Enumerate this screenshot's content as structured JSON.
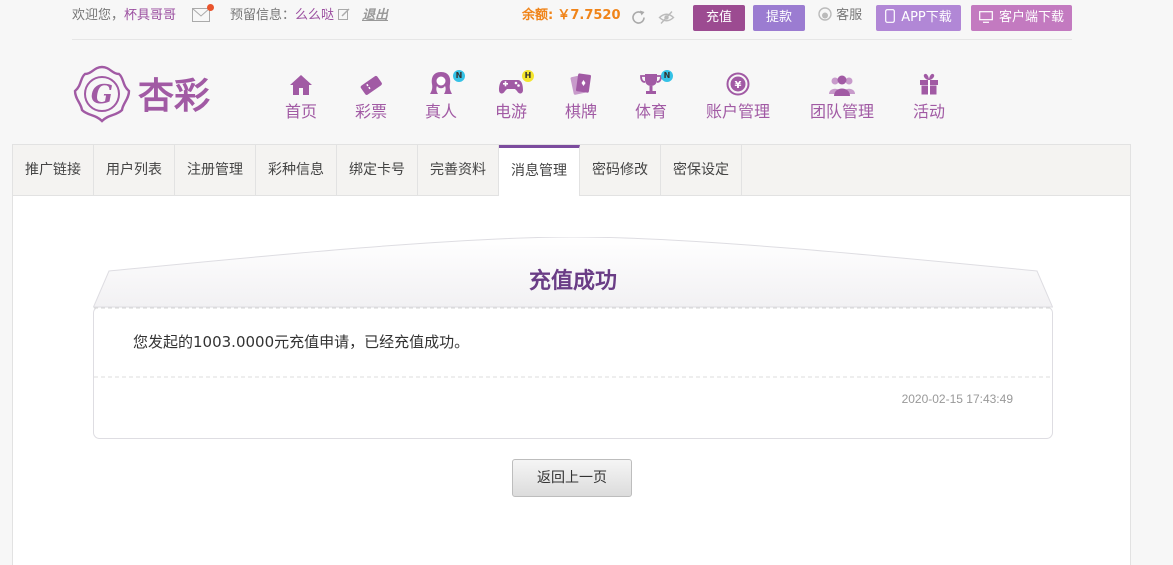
{
  "topbar": {
    "welcome": "欢迎您，",
    "username": "杯具哥哥",
    "reserved_label": "预留信息：",
    "reserved_value": "么么哒",
    "logout": "退出",
    "balance_label": "余额:",
    "balance_value": "￥7.7520",
    "recharge": "充值",
    "withdraw": "提款",
    "service": "客服",
    "app_download": "APP下载",
    "client_download": "客户端下载"
  },
  "logo": {
    "text": "杏彩"
  },
  "nav": [
    {
      "label": "首页",
      "icon": "home-icon"
    },
    {
      "label": "彩票",
      "icon": "lottery-ticket-icon"
    },
    {
      "label": "真人",
      "icon": "live-dealer-icon",
      "badge": "N"
    },
    {
      "label": "电游",
      "icon": "gamepad-icon",
      "badge": "H"
    },
    {
      "label": "棋牌",
      "icon": "cards-icon"
    },
    {
      "label": "体育",
      "icon": "trophy-icon",
      "badge": "N"
    },
    {
      "label": "账户管理",
      "icon": "yen-coin-icon"
    },
    {
      "label": "团队管理",
      "icon": "team-icon"
    },
    {
      "label": "活动",
      "icon": "gift-icon"
    }
  ],
  "tabs": [
    {
      "label": "推广链接"
    },
    {
      "label": "用户列表"
    },
    {
      "label": "注册管理"
    },
    {
      "label": "彩种信息"
    },
    {
      "label": "绑定卡号"
    },
    {
      "label": "完善资料"
    },
    {
      "label": "消息管理",
      "active": true
    },
    {
      "label": "密码修改"
    },
    {
      "label": "密保设定"
    }
  ],
  "message": {
    "title": "充值成功",
    "body": "您发起的1003.0000元充值申请，已经充值成功。",
    "time": "2020-02-15 17:43:49"
  },
  "back_button": "返回上一页",
  "colors": {
    "brand": "#a15aa4",
    "title": "#6a3d86",
    "balance": "#f08419",
    "recharge": "#9c4b91",
    "withdraw": "#9b7cd1"
  }
}
